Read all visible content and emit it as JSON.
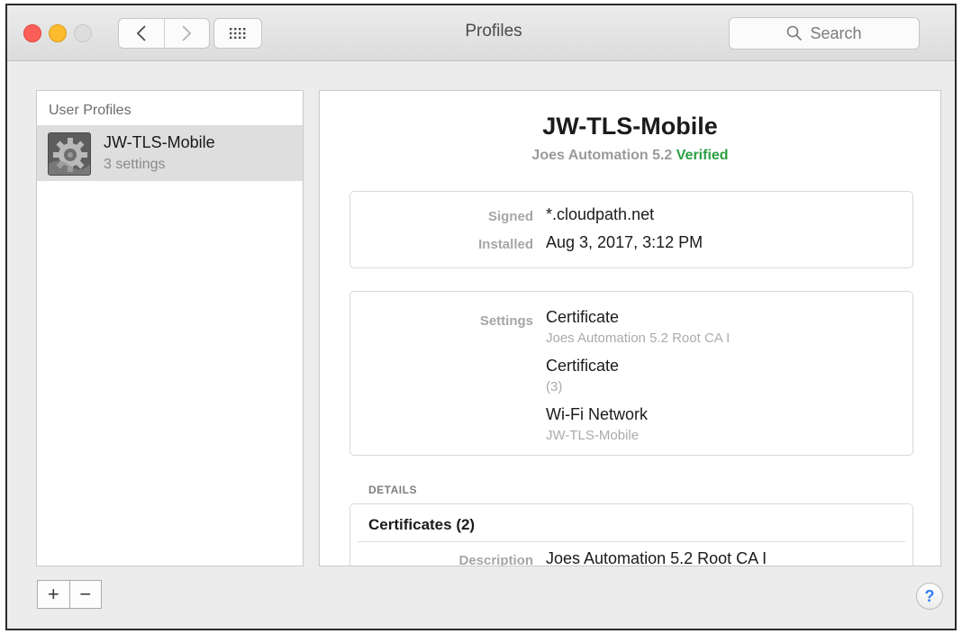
{
  "window": {
    "title": "Profiles",
    "search_placeholder": "Search",
    "accent_color": "#2aa043",
    "icons": {
      "back": "chevron-left-icon",
      "forward": "chevron-right-icon",
      "grid": "grid-icon",
      "search": "search-icon",
      "help": "help-icon"
    }
  },
  "sidebar": {
    "header": "User Profiles",
    "profiles": [
      {
        "name": "JW-TLS-Mobile",
        "subtitle": "3 settings",
        "selected": true
      }
    ],
    "add_label": "+",
    "remove_label": "−"
  },
  "detail": {
    "title": "JW-TLS-Mobile",
    "org": "Joes Automation 5.2",
    "status": "Verified",
    "signed_label": "Signed",
    "signed_value": "*.cloudpath.net",
    "installed_label": "Installed",
    "installed_value": "Aug 3, 2017, 3:12 PM",
    "settings_label": "Settings",
    "settings": [
      {
        "title": "Certificate",
        "subtitle": "Joes Automation 5.2 Root CA I"
      },
      {
        "title": "Certificate",
        "subtitle": "(3)"
      },
      {
        "title": "Wi-Fi Network",
        "subtitle": "JW-TLS-Mobile"
      }
    ],
    "details_label": "DETAILS",
    "certificates_heading": "Certificates (2)",
    "description_label": "Description",
    "description_value": "Joes Automation 5.2 Root CA I"
  },
  "help_label": "?"
}
